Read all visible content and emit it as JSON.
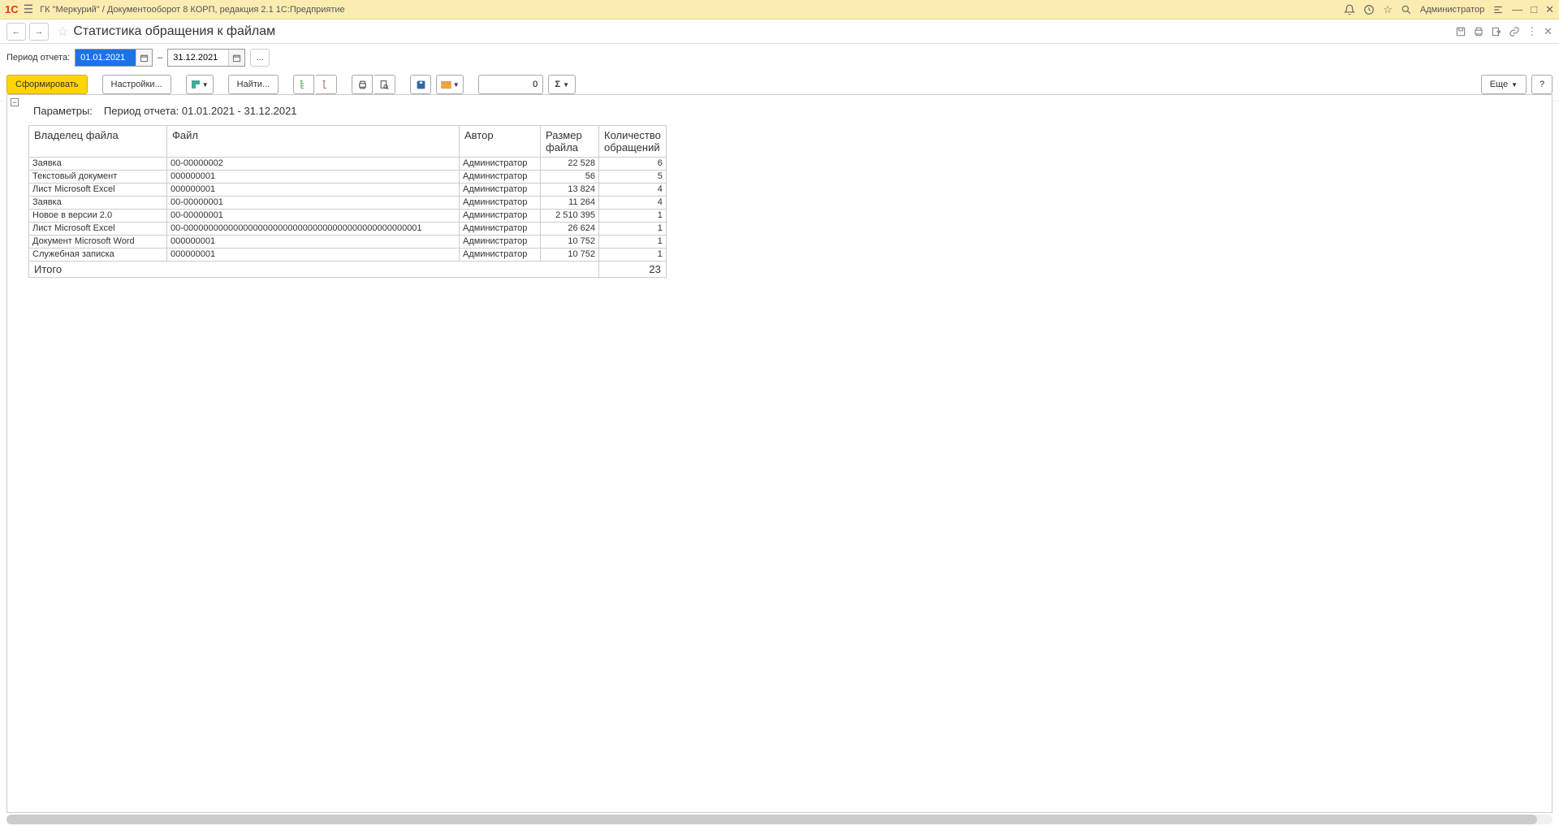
{
  "titlebar": {
    "logo": "1С",
    "title": "ГК \"Меркурий\" / Документооборот 8 КОРП, редакция 2.1 1С:Предприятие",
    "user": "Администратор"
  },
  "header": {
    "page_title": "Статистика обращения к файлам"
  },
  "params": {
    "label": "Период отчета:",
    "date_from": "01.01.2021",
    "date_to": "31.12.2021",
    "dash": "–",
    "ellipsis": "..."
  },
  "toolbar": {
    "generate": "Сформировать",
    "settings": "Настройки...",
    "find": "Найти...",
    "number_value": "0",
    "sigma": "Σ",
    "more": "Еще",
    "help": "?"
  },
  "report": {
    "collapse": "−",
    "params_label": "Параметры:",
    "params_value": "Период отчета: 01.01.2021 - 31.12.2021",
    "headers": {
      "owner": "Владелец файла",
      "file": "Файл",
      "author": "Автор",
      "size": "Размер файла",
      "count": "Количество обращений"
    },
    "rows": [
      {
        "owner": "Заявка",
        "file": "00-00000002",
        "author": "Администратор",
        "size": "22 528",
        "count": "6"
      },
      {
        "owner": "Текстовый документ",
        "file": "000000001",
        "author": "Администратор",
        "size": "56",
        "count": "5"
      },
      {
        "owner": "Лист Microsoft Excel",
        "file": "000000001",
        "author": "Администратор",
        "size": "13 824",
        "count": "4"
      },
      {
        "owner": "Заявка",
        "file": "00-00000001",
        "author": "Администратор",
        "size": "11 264",
        "count": "4"
      },
      {
        "owner": "Новое в версии 2.0",
        "file": "00-00000001",
        "author": "Администратор",
        "size": "2 510 395",
        "count": "1"
      },
      {
        "owner": "Лист Microsoft Excel",
        "file": "00-000000000000000000000000000000000000000000000001",
        "author": "Администратор",
        "size": "26 624",
        "count": "1"
      },
      {
        "owner": "Документ Microsoft Word",
        "file": "000000001",
        "author": "Администратор",
        "size": "10 752",
        "count": "1"
      },
      {
        "owner": "Служебная записка",
        "file": "000000001",
        "author": "Администратор",
        "size": "10 752",
        "count": "1"
      }
    ],
    "total": {
      "label": "Итого",
      "count": "23"
    }
  }
}
